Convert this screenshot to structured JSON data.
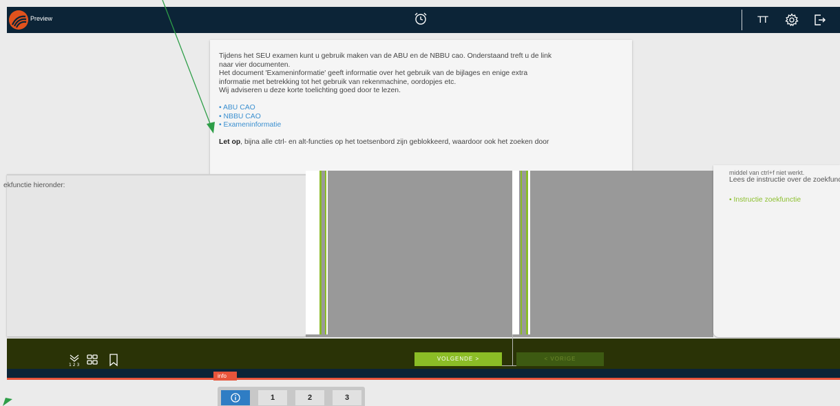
{
  "header": {
    "preview_label": "Preview",
    "text_size_label": "TT"
  },
  "content": {
    "intro_line1": "Tijdens het SEU examen kunt u gebruik maken van de ABU en de NBBU cao. Onderstaand treft u de link",
    "intro_line2": "naar vier documenten.",
    "doc_line1": "Het document 'Exameninformatie' geeft informatie over het gebruik van de bijlages en enige extra",
    "doc_line2": "informatie met betrekking tot het gebruik van rekenmachine, oordopjes etc.",
    "advice_line": "Wij adviseren u deze korte toelichting goed door te lezen.",
    "links": [
      "• ABU CAO",
      "• NBBU CAO",
      "• Exameninformatie"
    ],
    "warning_bold": "Let op",
    "warning_rest": ", bijna alle ctrl- en alt-functies op het toetsenbord zijn geblokkeerd, waardoor ook het zoeken door"
  },
  "left_panel": {
    "text": "ekfunctie hieronder:"
  },
  "right_panel": {
    "cut_line": "middel van ctrl+f niet werkt.",
    "instruction_line": "Lees de instructie over de zoekfunctie",
    "link": "• Instructie zoekfunctie"
  },
  "navigation": {
    "next_label": "VOLGENDE  >",
    "prev_label": "<  VORIGE"
  },
  "info_tab": "info",
  "pager": {
    "items": [
      "1",
      "2",
      "3"
    ]
  },
  "colors": {
    "topbar": "#0c2437",
    "accent_orange": "#e8553b",
    "green": "#8bbd26",
    "link_blue": "#3a8fd0",
    "pager_active": "#2f7dc4"
  }
}
